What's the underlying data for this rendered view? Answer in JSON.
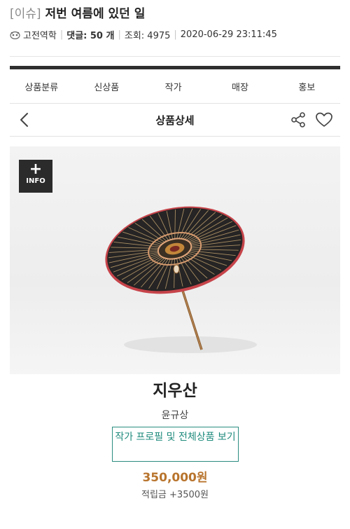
{
  "post": {
    "tag": "[이슈]",
    "title": "저번 여름에 있던 일",
    "author": "고전역학",
    "comments": "댓글: 50 개",
    "views": "조회: 4975",
    "datetime": "2020-06-29 23:11:45"
  },
  "nav": {
    "tabs": [
      "상품분류",
      "신상품",
      "작가",
      "매장",
      "홍보"
    ]
  },
  "detail": {
    "title": "상품상세"
  },
  "info_button": {
    "plus": "+",
    "label": "INFO"
  },
  "product": {
    "name": "지우산",
    "artist": "윤규상",
    "profile_button": "작가 프로필 및 전체상품 보기",
    "price": "350,000원",
    "points": "적립금 +3500원"
  },
  "colors": {
    "accent_teal": "#1e8a7c",
    "price_orange": "#b8742d",
    "top_bar": "#2f2f2f"
  },
  "icons": [
    "author-icon",
    "back-chevron-icon",
    "share-icon",
    "heart-icon",
    "plus-icon"
  ]
}
